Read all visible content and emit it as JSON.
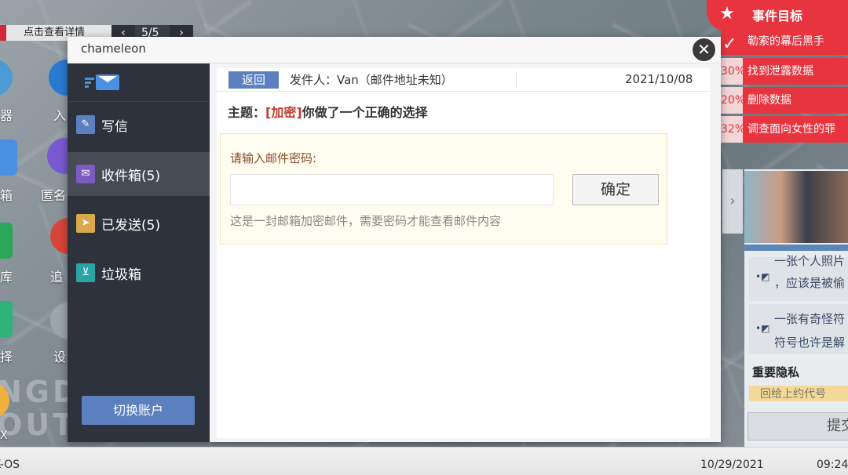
{
  "desktop": {
    "hint": "点击查看详情",
    "pager": {
      "count": "5/5",
      "prev": "‹",
      "next": "›"
    },
    "icons": [
      {
        "label": "器",
        "color": "#4a9bd8"
      },
      {
        "label": "入",
        "color": "#2a7ad2"
      },
      {
        "label": "箱",
        "color": "#4a90e2"
      },
      {
        "label": "匿名",
        "color": "#7a5ad2"
      },
      {
        "label": "库",
        "color": "#d8453a"
      },
      {
        "label": "追",
        "color": "#d8453a"
      },
      {
        "label": "择",
        "color": "#2db37a"
      },
      {
        "label": "设",
        "color": "#9aa5ad"
      }
    ],
    "watermark": [
      "NGD",
      "OUTI"
    ],
    "watermark_x": "X"
  },
  "event_panel": {
    "title": "事件目标",
    "star": "★",
    "check": "✓",
    "items": [
      {
        "label": "勒索的幕后黑手",
        "pct": ""
      },
      {
        "label": "找到泄露数据",
        "pct": "30%"
      },
      {
        "label": "删除数据",
        "pct": "20%"
      },
      {
        "label": "调查面向女性的罪",
        "pct": "32%"
      }
    ]
  },
  "evidence_panel": {
    "arrow": "›",
    "rows": [
      {
        "pin": "•◩",
        "line1": "一张个人照片",
        "line2": "，应该是被偷"
      },
      {
        "pin": "•◩",
        "line1": "一张有奇怪符",
        "line2": "符号也许是解"
      }
    ],
    "heading": "重要隐私",
    "yellow_text": "回给上约代号",
    "submit": "提交"
  },
  "mail": {
    "window_title": "chameleon",
    "close": "✕",
    "sidebar": {
      "items": [
        {
          "label": "写信",
          "icon": "✎",
          "icon_color": "#5b7fbf",
          "active": false
        },
        {
          "label": "收件箱(5)",
          "icon": "✉",
          "icon_color": "#7d5ac0",
          "active": true
        },
        {
          "label": "已发送(5)",
          "icon": "➤",
          "icon_color": "#d8a84a",
          "active": false
        },
        {
          "label": "垃圾箱",
          "icon": "⊻",
          "icon_color": "#2aa5a5",
          "active": false
        }
      ],
      "switch_account": "切换账户"
    },
    "header": {
      "back": "返回",
      "sender": "发件人：Van（邮件地址未知）",
      "date": "2021/10/08"
    },
    "subject": {
      "prefix": "主题：",
      "tag": "[加密]",
      "text": "你做了一个正确的选择"
    },
    "password_box": {
      "label": "请输入邮件密码:",
      "input_value": "",
      "input_placeholder": "",
      "confirm": "确定",
      "hint": "这是一封邮箱加密邮件，需要密码才能查看邮件内容"
    }
  },
  "taskbar": {
    "os": "K-OS",
    "date": "10/29/2021",
    "time": "09:24"
  }
}
